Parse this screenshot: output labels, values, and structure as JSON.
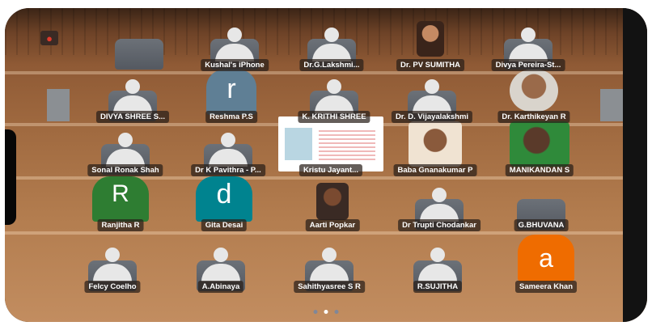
{
  "meeting": {
    "rec_icon": "recording-icon",
    "page_indicator": {
      "count": 3,
      "active": 2
    }
  },
  "row1": [
    "Kushal's iPhone",
    "Dr.G.Lakshmi...",
    "Dr. PV SUMITHA",
    "Divya Pereira-St..."
  ],
  "row2": [
    "DIVYA SHREE S...",
    "Reshma P.S",
    "K. KRITHI SHREE",
    "Dr. D. Vijayalakshmi",
    "Dr. Karthikeyan R"
  ],
  "row3": [
    "Sonal Ronak Shah",
    "Dr K Pavithra - P...",
    "Kristu Jayant...",
    "Baba Gnanakumar P",
    "MANIKANDAN S"
  ],
  "row4": [
    "Ranjitha R",
    "Gita Desai",
    "Aarti Popkar",
    "Dr Trupti Chodankar",
    "G.BHUVANA"
  ],
  "row5": [
    "Felcy Coelho",
    "A.Abinaya",
    "Sahithyasree S R",
    "R.SUJITHA",
    "Sameera Khan"
  ],
  "avatars": {
    "reshma": {
      "letter": "r",
      "color": "#5f7f95"
    },
    "ranjitha": {
      "letter": "R",
      "color": "#2e7d32"
    },
    "gita": {
      "letter": "d",
      "color": "#00838f"
    },
    "sameera": {
      "letter": "a",
      "color": "#ef6c00"
    }
  }
}
